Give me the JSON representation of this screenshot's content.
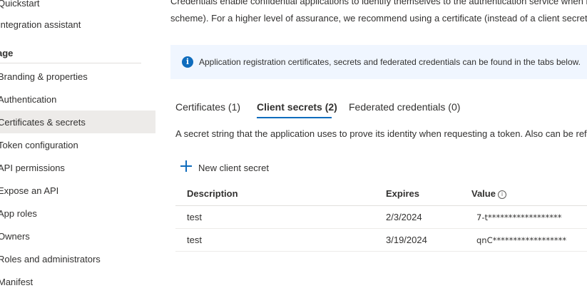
{
  "sidebar": {
    "items_top": [
      "Quickstart",
      "Integration assistant"
    ],
    "section_header": "age",
    "items": [
      "Branding & properties",
      "Authentication",
      "Certificates & secrets",
      "Token configuration",
      "API permissions",
      "Expose an API",
      "App roles",
      "Owners",
      "Roles and administrators",
      "Manifest"
    ],
    "selected_index": 2
  },
  "main": {
    "intro_line1": "Credentials enable confidential applications to identify themselves to the authentication service when re",
    "intro_line2": "scheme). For a higher level of assurance, we recommend using a certificate (instead of a client secret) a",
    "info_banner": "Application registration certificates, secrets and federated credentials can be found in the tabs below.",
    "tabs": [
      "Certificates (1)",
      "Client secrets (2)",
      "Federated credentials (0)"
    ],
    "active_tab_index": 1,
    "description": "A secret string that the application uses to prove its identity when requesting a token. Also can be ref",
    "new_secret_label": "New client secret",
    "table": {
      "headers": [
        "Description",
        "Expires",
        "Value"
      ],
      "rows": [
        {
          "description": "test",
          "expires": "2/3/2024",
          "value": "7-t******************"
        },
        {
          "description": "test",
          "expires": "3/19/2024",
          "value": "qnC******************"
        }
      ]
    }
  },
  "colors": {
    "accent": "#0f6cbd",
    "banner_bg": "#f0f6ff",
    "selected_bg": "#edebe9"
  }
}
